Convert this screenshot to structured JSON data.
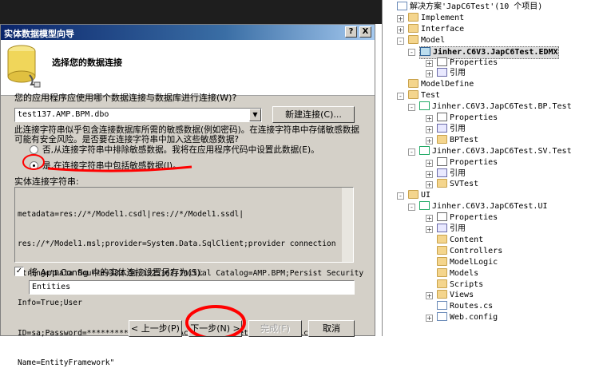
{
  "background": {
    "strip_text": ""
  },
  "dialog": {
    "title": "实体数据模型向导",
    "help_button": "?",
    "close_button": "X",
    "heading": "选择您的数据连接",
    "question": "您的应用程序应使用哪个数据连接与数据库进行连接(W)?",
    "connection_value": "test137.AMP.BPM.dbo",
    "new_connection_button": "新建连接(C)...",
    "warning_line1": "此连接字符串似乎包含连接数据库所需的敏感数据(例如密码)。在连接字符串中存储敏感数据",
    "warning_line2": "可能有安全风险。是否要在连接字符串中加入这些敏感数据?",
    "option_exclude": "否,从连接字符串中排除敏感数据。我将在应用程序代码中设置此数据(E)。",
    "option_include": "是,在连接字符串中包括敏感数据(I)。",
    "selected_option": "include",
    "conn_string_label": "实体连接字符串:",
    "conn_string_lines": [
      "metadata=res://*/Model1.csdl|res://*/Model1.ssdl|",
      "res://*/Model1.msl;provider=System.Data.SqlClient;provider connection",
      "string=\"Data Source=183.56.132.162;Initial Catalog=AMP.BPM;Persist Security",
      "Info=True;User",
      "ID=sa;Password=***********;MultipleActiveResultSets=True;Application",
      "Name=EntityFramework\""
    ],
    "save_config_label": "将 App.Config 中的实体连接设置另存为(S):",
    "save_config_checked": true,
    "entities_value": "Entities",
    "buttons": {
      "prev": "< 上一步(P)",
      "next": "下一步(N) >",
      "finish": "完成(F)",
      "cancel": "取消"
    }
  },
  "solution": {
    "rows": [
      {
        "text": "解决方案'JapC6Test'(10 个项目)",
        "icon": "solution",
        "expander": ""
      },
      {
        "text": "Implement",
        "icon": "folder",
        "expander": "+"
      },
      {
        "text": "Interface",
        "icon": "folder",
        "expander": "+"
      },
      {
        "text": "Model",
        "icon": "folder",
        "expander": "-"
      },
      {
        "text": "Jinher.C6V3.JapC6Test.EDMX",
        "icon": "project",
        "expander": "-"
      },
      {
        "text": "Properties",
        "icon": "props",
        "expander": "+"
      },
      {
        "text": "引用",
        "icon": "ref",
        "expander": "+"
      },
      {
        "text": "ModelDefine",
        "icon": "folder",
        "expander": ""
      },
      {
        "text": "Test",
        "icon": "folder",
        "expander": "-"
      },
      {
        "text": "Jinher.C6V3.JapC6Test.BP.Test",
        "icon": "project",
        "expander": "-"
      },
      {
        "text": "Properties",
        "icon": "props",
        "expander": "+"
      },
      {
        "text": "引用",
        "icon": "ref",
        "expander": "+"
      },
      {
        "text": "BPTest",
        "icon": "folder",
        "expander": "+"
      },
      {
        "text": "Jinher.C6V3.JapC6Test.SV.Test",
        "icon": "project",
        "expander": "-"
      },
      {
        "text": "Properties",
        "icon": "props",
        "expander": "+"
      },
      {
        "text": "引用",
        "icon": "ref",
        "expander": "+"
      },
      {
        "text": "SVTest",
        "icon": "folder",
        "expander": "+"
      },
      {
        "text": "UI",
        "icon": "folder",
        "expander": "-"
      },
      {
        "text": "Jinher.C6V3.JapC6Test.UI",
        "icon": "project",
        "expander": "-"
      },
      {
        "text": "Properties",
        "icon": "props",
        "expander": "+"
      },
      {
        "text": "引用",
        "icon": "ref",
        "expander": "+"
      },
      {
        "text": "Content",
        "icon": "folder",
        "expander": ""
      },
      {
        "text": "Controllers",
        "icon": "folder",
        "expander": ""
      },
      {
        "text": "ModelLogic",
        "icon": "folder",
        "expander": ""
      },
      {
        "text": "Models",
        "icon": "folder",
        "expander": ""
      },
      {
        "text": "Scripts",
        "icon": "folder",
        "expander": ""
      },
      {
        "text": "Views",
        "icon": "folder",
        "expander": "+"
      },
      {
        "text": "Routes.cs",
        "icon": "file",
        "expander": ""
      },
      {
        "text": "Web.config",
        "icon": "file",
        "expander": "+"
      }
    ]
  },
  "colors": {
    "dialog_bg": "#d4d0c8",
    "title_bar": "#0a246a",
    "annotation": "#ff0000"
  }
}
